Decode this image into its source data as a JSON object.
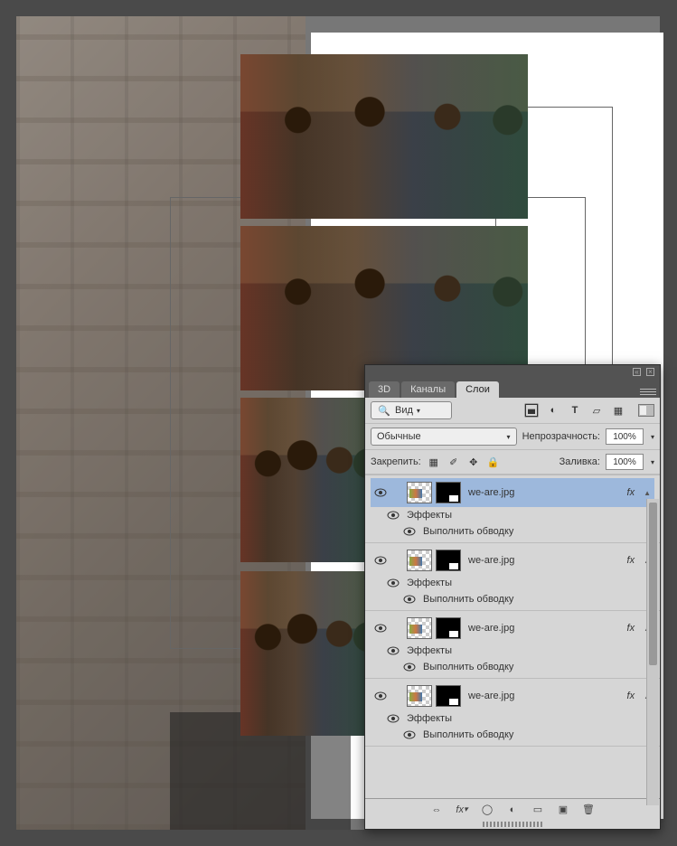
{
  "tabs": {
    "t1": "3D",
    "t2": "Каналы",
    "t3": "Слои"
  },
  "filter": {
    "label": "Вид"
  },
  "blend": {
    "mode": "Обычные",
    "opacity_label": "Непрозрачность:",
    "opacity_value": "100%"
  },
  "lock": {
    "label": "Закрепить:",
    "fill_label": "Заливка:",
    "fill_value": "100%"
  },
  "layer_name": "we-are.jpg",
  "fx_label": "fx",
  "effects": "Эффекты",
  "stroke": "Выполнить обводку",
  "icons": {
    "image": "□",
    "adjust": "◐",
    "text": "T",
    "shape": "▭",
    "smart": "▦",
    "lock_px": "▦",
    "brush": "✎",
    "move": "✥",
    "lock": "🔒",
    "link": "⛓",
    "fxb": "fx",
    "mask": "◯",
    "adj": "◐",
    "group": "▭",
    "new": "▣",
    "trash": "🗑"
  }
}
